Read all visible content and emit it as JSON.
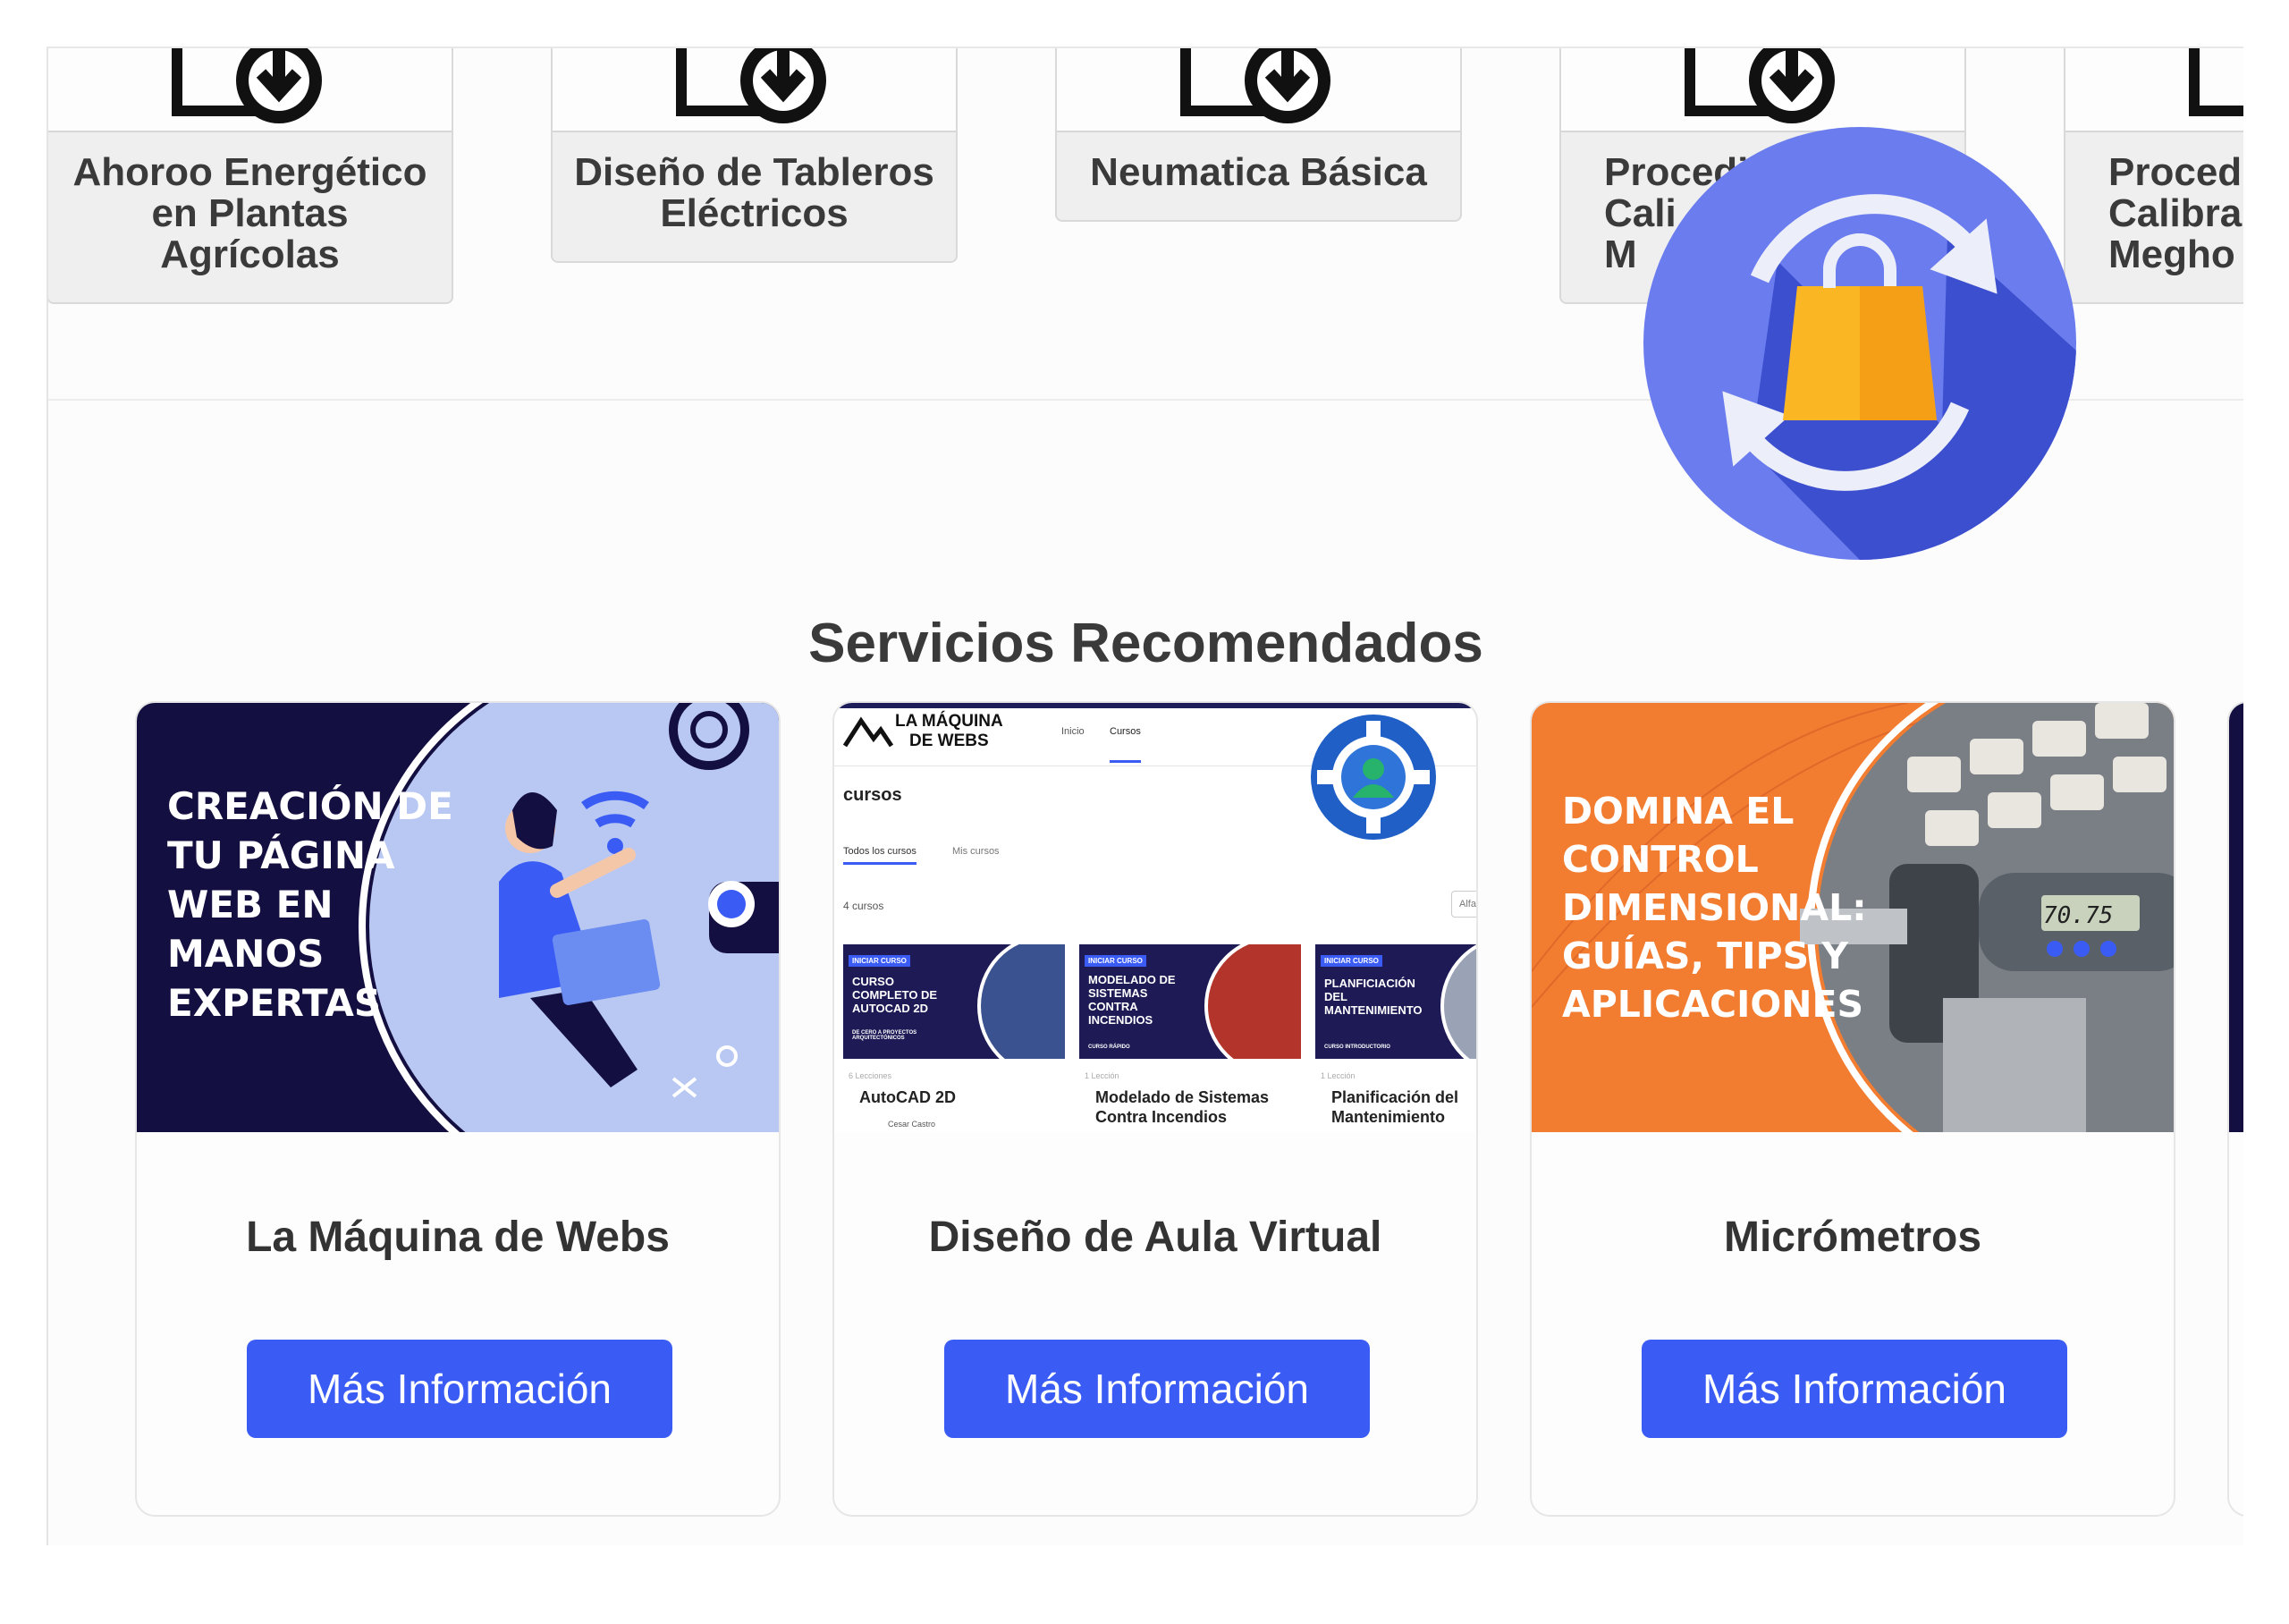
{
  "products": [
    {
      "title": "Ahoroo Energético\nen Plantas\nAgrícolas",
      "icon": "download-doc-icon"
    },
    {
      "title": "Diseño de Tableros\nEléctricos",
      "icon": "download-doc-icon"
    },
    {
      "title": "Neumatica Básica",
      "icon": "download-doc-icon"
    },
    {
      "title": "Procedi\nCali\nM",
      "icon": "download-doc-icon"
    },
    {
      "title": "Procedir\nCalibra\nMegho",
      "icon": "download-doc-icon"
    }
  ],
  "section": {
    "title": "Servicios Recomendados"
  },
  "services": [
    {
      "title": "La Máquina de Webs",
      "button": "Más Información",
      "image_text": "CREACIÓN DE\nTU PÁGINA\nWEB EN\nMANOS\nEXPERTAS"
    },
    {
      "title": "Diseño de Aula Virtual",
      "button": "Más Información",
      "image_logo": "LA MÁQUINA\nDE WEBS",
      "image_nav": [
        "Inicio",
        "Cursos"
      ],
      "image_heading": "cursos",
      "image_tabs": [
        "Todos los cursos",
        "Mis cursos"
      ],
      "image_count": "4 cursos",
      "image_filter": "Alfa",
      "image_courses": [
        {
          "tag": "INICIAR CURSO",
          "banner": "CURSO\nCOMPLETO DE\nAUTOCAD 2D",
          "sub": "DE CERO A PROYECTOS ARQUITECTÓNICOS",
          "meta": "6 Lecciones",
          "name": "AutoCAD 2D",
          "author": "Cesar Castro"
        },
        {
          "tag": "INICIAR CURSO",
          "banner": "MODELADO DE\nSISTEMAS\nCONTRA\nINCENDIOS",
          "sub": "CURSO RÁPIDO",
          "meta": "1 Lección",
          "name": "Modelado de Sistemas\nContra Incendios",
          "author": ""
        },
        {
          "tag": "INICIAR CURSO",
          "banner": "PLANFICIACIÓN\nDEL\nMANTENIMIENTO",
          "sub": "CURSO INTRODUCTORIO",
          "meta": "1 Lección",
          "name": "Planificación del\nMantenimiento",
          "author": ""
        }
      ]
    },
    {
      "title": "Micrómetros",
      "button": "Más Información",
      "image_text": "DOMINA EL\nCONTROL\nDIMENSIONAL:\nGUÍAS, TIPS Y\nAPLICACIONES",
      "image_reading": "70.75"
    }
  ],
  "colors": {
    "button": "#3a5cf5",
    "navy": "#130f40",
    "orange": "#f27c30",
    "cart_circle": "#6b7cee"
  }
}
